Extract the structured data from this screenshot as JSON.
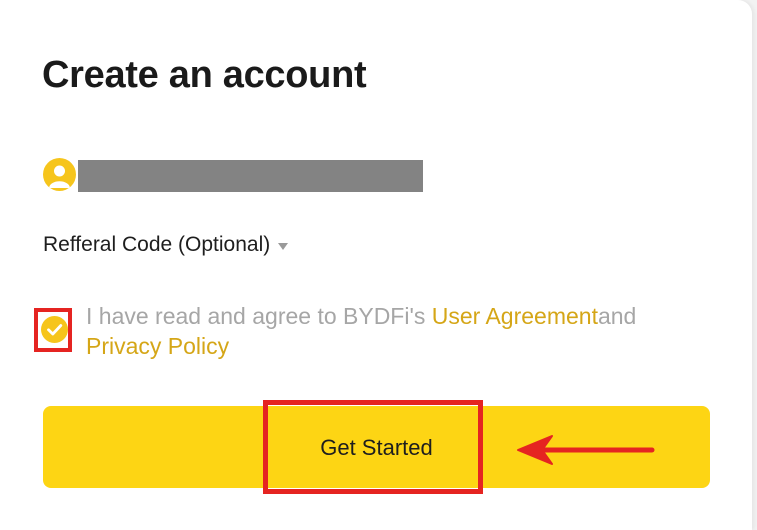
{
  "form": {
    "title": "Create an account",
    "avatar_icon": "user-avatar-icon",
    "referral_label": "Refferal Code (Optional)",
    "referral_icon": "caret-down-icon",
    "agreement": {
      "checked": true,
      "prefix": "I have read and agree to BYDFi's ",
      "user_agreement_link": "User Agreement",
      "and_text": "and",
      "privacy_policy_link": "Privacy Policy"
    },
    "submit_label": "Get Started"
  },
  "colors": {
    "brand_yellow": "#fdd514",
    "link_gold": "#d5a617",
    "annotation_red": "#e52421",
    "muted_text": "#a6a6a6",
    "redacted_gray": "#838383"
  },
  "annotations": {
    "arrow_icon": "left-arrow-icon"
  }
}
